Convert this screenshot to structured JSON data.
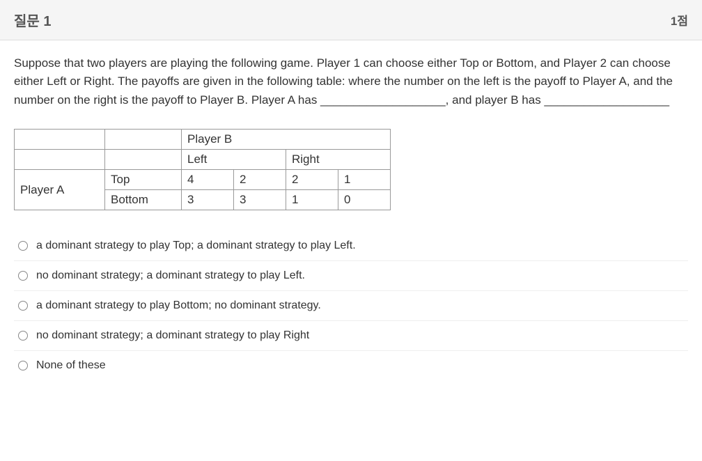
{
  "header": {
    "title": "질문 1",
    "points": "1점"
  },
  "prompt": "Suppose that two players are playing the following game. Player 1 can choose either Top or Bottom, and Player 2 can choose either Left or Right. The payoffs are given in the following table: where the number on the left is the payoff to Player A, and the number on the right is the payoff to Player B. Player A has ___________________, and player B has ___________________",
  "table": {
    "player_b_label": "Player B",
    "player_a_label": "Player A",
    "col_left": "Left",
    "col_right": "Right",
    "rows": [
      {
        "name": "Top",
        "left_a": "4",
        "left_b": "2",
        "right_a": "2",
        "right_b": "1"
      },
      {
        "name": "Bottom",
        "left_a": "3",
        "left_b": "3",
        "right_a": "1",
        "right_b": "0"
      }
    ]
  },
  "choices": [
    "a dominant strategy to play Top; a dominant strategy to play Left.",
    "no dominant strategy; a dominant strategy to play Left.",
    "a dominant strategy to play Bottom; no dominant strategy.",
    "no dominant strategy; a dominant strategy to play Right",
    "None of these"
  ]
}
